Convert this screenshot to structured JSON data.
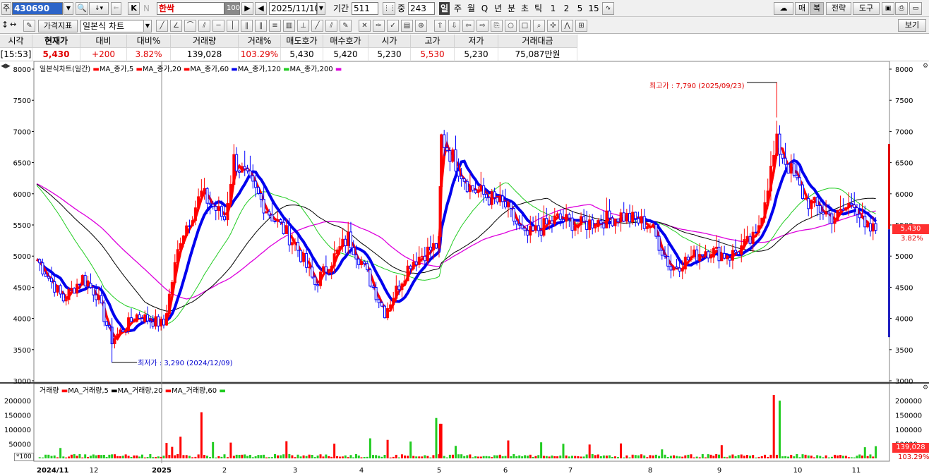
{
  "toolbar": {
    "code_prefix": "주",
    "stock_code": "430690",
    "k_label": "K",
    "n_label": "N",
    "stock_name": "한싹",
    "zoom_value": "100",
    "date": "2025/11/10",
    "period_label": "기간",
    "period_value": "511",
    "mid_label": "중",
    "mid_value": "243",
    "periods": [
      "일",
      "주",
      "월",
      "Q",
      "년",
      "분",
      "초",
      "틱",
      "1",
      "2",
      "5",
      "15"
    ],
    "right_buttons": [
      "매",
      "복",
      "전략",
      "도구"
    ],
    "indicator_button": "가격지표",
    "chart_type": "일본식 차트",
    "view_button": "보기"
  },
  "quote": {
    "headers": [
      "시각",
      "현재가",
      "대비",
      "대비%",
      "거래량",
      "거래%",
      "매도호가",
      "매수호가",
      "시가",
      "고가",
      "저가",
      "거래대금"
    ],
    "values": [
      "[15:53]",
      "5,430",
      "+200",
      "3.82%",
      "139,028",
      "103.29%",
      "5,430",
      "5,420",
      "5,230",
      "5,530",
      "5,230",
      "75,087만원"
    ]
  },
  "legend": {
    "price_title": "일본식차트(일간)",
    "price_items": [
      "MA_종가,5",
      "MA_종가,20",
      "MA_종가,60",
      "MA_종가,120",
      "MA_종가,200"
    ],
    "volume_title": "거래량",
    "volume_items": [
      "MA_거래량,5",
      "MA_거래량,20",
      "MA_거래량,60"
    ]
  },
  "annotations": {
    "high_label": "최고가 : 7,790 (2025/09/23)",
    "low_label": "최저가 : 3,290 (2024/12/09)",
    "price_tag": "5,430",
    "pct_tag": "3.82%",
    "volume_tag": "139,028",
    "volume_pct_tag": "103.29%",
    "volume_unit": "*100"
  },
  "colors": {
    "up": "#ff0000",
    "down": "#0000ff",
    "ma5": "#ff0000",
    "ma20": "#0000ee",
    "ma60": "#22cc22",
    "ma120": "#000000",
    "ma200": "#dd00dd"
  },
  "chart_data": {
    "type": "candlestick",
    "price_axis": {
      "min": 3000,
      "max": 8000,
      "ticks": [
        3000,
        3500,
        4000,
        4500,
        5000,
        5500,
        6000,
        6500,
        7000,
        7500,
        8000
      ]
    },
    "volume_axis": {
      "min": 0,
      "max": 220000,
      "ticks": [
        50000,
        100000,
        150000,
        200000
      ]
    },
    "x_labels": [
      "2024/11",
      "12",
      "2025",
      "2",
      "3",
      "4",
      "5",
      "6",
      "7",
      "8",
      "9",
      "10",
      "11"
    ],
    "close_series": [
      {
        "date": "2024/11",
        "close": 4950
      },
      {
        "date": "2024/11/15",
        "close": 4300
      },
      {
        "date": "2024/11/25",
        "close": 4650
      },
      {
        "date": "2024/12/02",
        "close": 4400
      },
      {
        "date": "2024/12/09",
        "close": 3650
      },
      {
        "date": "2024/12/20",
        "close": 4050
      },
      {
        "date": "2025/01/02",
        "close": 3900
      },
      {
        "date": "2025/01/10",
        "close": 5300
      },
      {
        "date": "2025/01/20",
        "close": 6000
      },
      {
        "date": "2025/02/01",
        "close": 5600
      },
      {
        "date": "2025/02/05",
        "close": 6550
      },
      {
        "date": "2025/02/20",
        "close": 5700
      },
      {
        "date": "2025/03/01",
        "close": 5200
      },
      {
        "date": "2025/03/10",
        "close": 4550
      },
      {
        "date": "2025/03/25",
        "close": 5300
      },
      {
        "date": "2025/04/01",
        "close": 4900
      },
      {
        "date": "2025/04/10",
        "close": 4100
      },
      {
        "date": "2025/04/20",
        "close": 4900
      },
      {
        "date": "2025/05/01",
        "close": 5200
      },
      {
        "date": "2025/05/02",
        "close": 6900
      },
      {
        "date": "2025/05/15",
        "close": 6100
      },
      {
        "date": "2025/06/01",
        "close": 5800
      },
      {
        "date": "2025/06/10",
        "close": 5300
      },
      {
        "date": "2025/06/25",
        "close": 5600
      },
      {
        "date": "2025/07/05",
        "close": 5500
      },
      {
        "date": "2025/07/20",
        "close": 5650
      },
      {
        "date": "2025/08/01",
        "close": 5500
      },
      {
        "date": "2025/08/10",
        "close": 4800
      },
      {
        "date": "2025/08/25",
        "close": 5100
      },
      {
        "date": "2025/09/05",
        "close": 5000
      },
      {
        "date": "2025/09/15",
        "close": 5300
      },
      {
        "date": "2025/09/23",
        "close": 6800
      },
      {
        "date": "2025/10/05",
        "close": 5900
      },
      {
        "date": "2025/10/20",
        "close": 5600
      },
      {
        "date": "2025/10/30",
        "close": 5900
      },
      {
        "date": "2025/11/05",
        "close": 5400
      },
      {
        "date": "2025/11/10",
        "close": 5430
      }
    ],
    "last_close": 5430,
    "high": {
      "value": 7790,
      "date": "2025/09/23"
    },
    "low": {
      "value": 3290,
      "date": "2024/12/09"
    },
    "volume_peaks": [
      {
        "date": "2025/01/10",
        "value": 75000
      },
      {
        "date": "2025/01/20",
        "value": 160000
      },
      {
        "date": "2025/04/30",
        "value": 140000
      },
      {
        "date": "2025/05/02",
        "value": 120000
      },
      {
        "date": "2025/09/22",
        "value": 220000
      },
      {
        "date": "2025/09/24",
        "value": 200000
      },
      {
        "date": "2025/11/10",
        "value": 139028
      }
    ]
  }
}
